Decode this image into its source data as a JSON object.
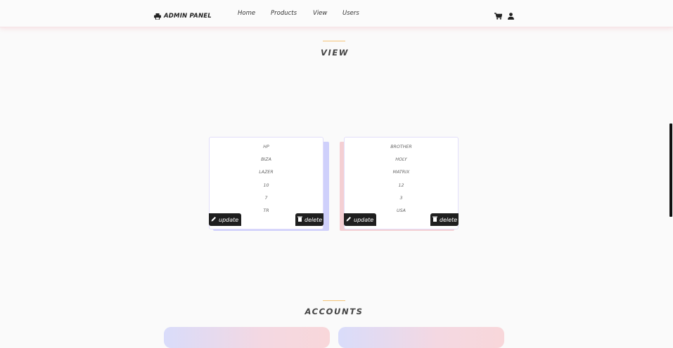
{
  "header": {
    "brand": "ADMIN PANEL",
    "nav": [
      "Home",
      "Products",
      "View",
      "Users"
    ]
  },
  "icons": {
    "brand": "printer-icon",
    "cart": "cart-icon",
    "user": "user-icon",
    "update": "pencil-icon",
    "delete": "trash-icon"
  },
  "view_section": {
    "title": "VIEW"
  },
  "products": [
    {
      "fields": [
        "HP",
        "BIZA",
        "LAZER",
        "10",
        "7",
        "TR"
      ],
      "update_label": "update",
      "delete_label": "delete"
    },
    {
      "fields": [
        "BROTHER",
        "HOLY",
        "MATRIX",
        "12",
        "3",
        "USA"
      ],
      "update_label": "update",
      "delete_label": "delete"
    }
  ],
  "accounts_section": {
    "title": "ACCOUNTS"
  },
  "colors": {
    "accent_line": "#f4c47a",
    "card1_shadow": "#cfd0fb",
    "card2_shadow": "#f4cfd3",
    "button_bg": "#1f1f1f"
  }
}
